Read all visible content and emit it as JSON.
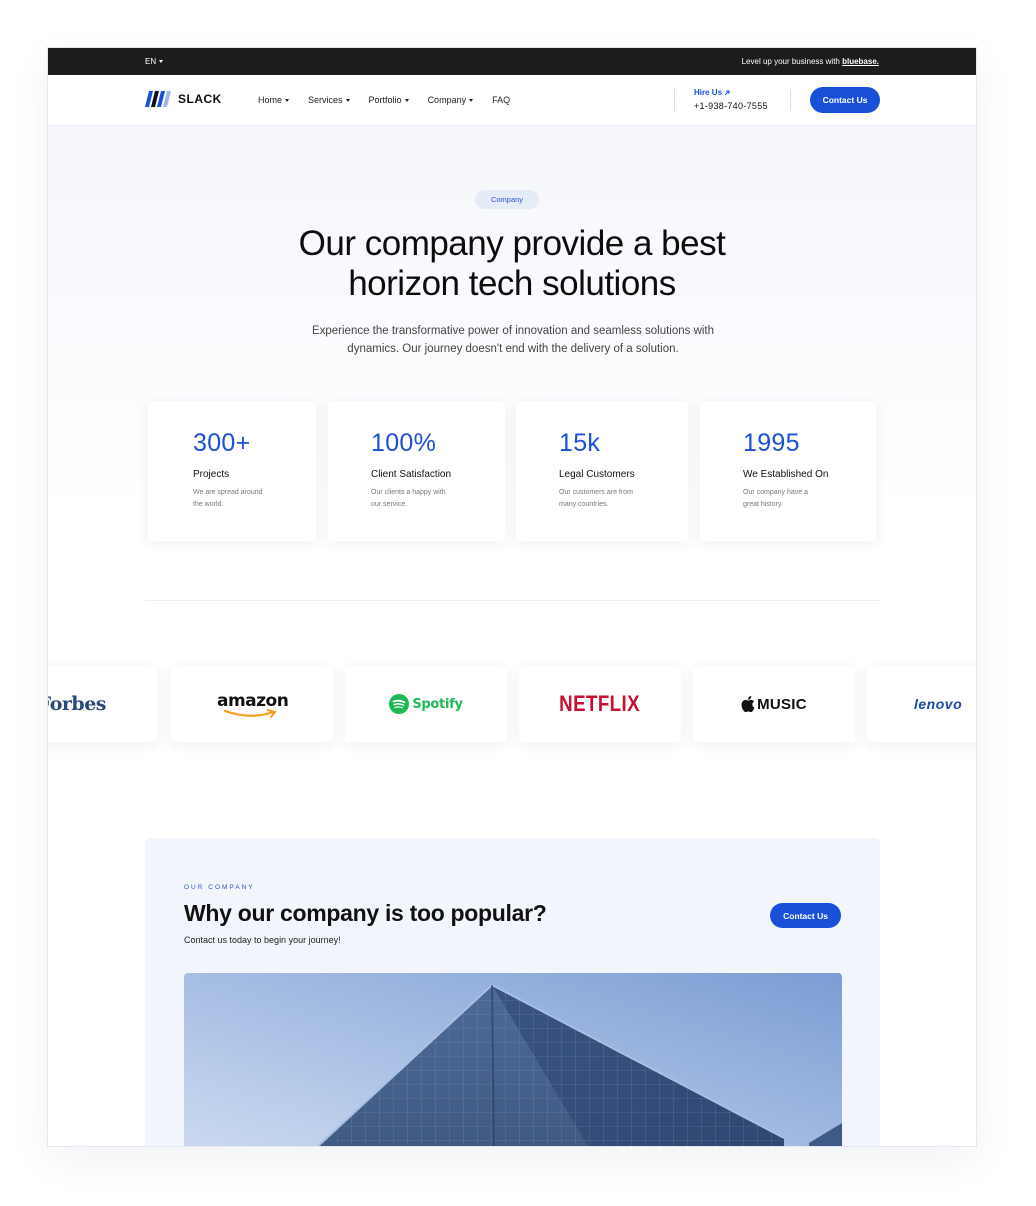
{
  "topbar": {
    "lang": "EN",
    "tagline_prefix": "Level up your business with ",
    "tagline_brand": "bluebase."
  },
  "nav": {
    "logo_text": "SLACK",
    "items": [
      {
        "label": "Home",
        "has_dropdown": true
      },
      {
        "label": "Services",
        "has_dropdown": true
      },
      {
        "label": "Portfolio",
        "has_dropdown": true
      },
      {
        "label": "Company",
        "has_dropdown": true
      },
      {
        "label": "FAQ",
        "has_dropdown": false
      }
    ],
    "hire_label": "Hire Us",
    "phone": "+1-938-740-7555",
    "cta": "Contact Us"
  },
  "hero": {
    "badge": "Company",
    "title_line1": "Our company provide a best",
    "title_line2": "horizon tech solutions",
    "subtitle_line1": "Experience the transformative power of innovation and seamless solutions with",
    "subtitle_line2": "dynamics. Our journey doesn't end with the delivery of a solution."
  },
  "stats": [
    {
      "value": "300+",
      "label": "Projects",
      "desc_line1": "We are spread around",
      "desc_line2": "the world."
    },
    {
      "value": "100%",
      "label": "Client Satisfaction",
      "desc_line1": "Our clients a happy with",
      "desc_line2": "our service."
    },
    {
      "value": "15k",
      "label": "Legal Customers",
      "desc_line1": "Our customers are from",
      "desc_line2": "many countries."
    },
    {
      "value": "1995",
      "label": "We Established On",
      "desc_line1": "Our company have a",
      "desc_line2": "great history."
    }
  ],
  "brands": {
    "forbes": "Forbes",
    "amazon": "amazon",
    "spotify": "Spotify",
    "netflix": "NETFLIX",
    "apple_music": "MUSIC",
    "lenovo": "lenovo"
  },
  "company_section": {
    "eyebrow": "OUR COMPANY",
    "title": "Why our company is too popular?",
    "subtitle": "Contact us today to begin your journey!",
    "cta": "Contact Us"
  },
  "colors": {
    "accent": "#1a4fd8",
    "topbar_bg": "#1c1c1c",
    "netflix": "#c8102e",
    "spotify": "#1db954",
    "forbes": "#2b4a78",
    "lenovo": "#1b4aa8"
  }
}
